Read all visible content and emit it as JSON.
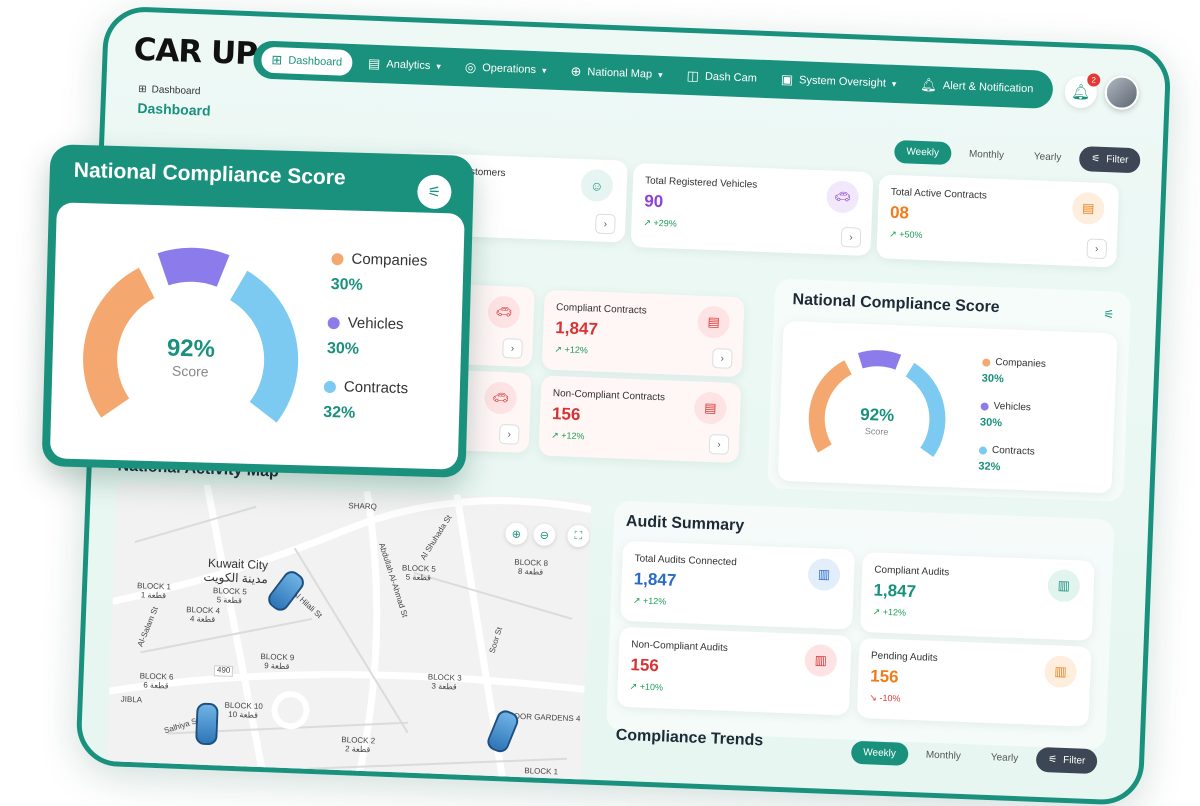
{
  "brand": {
    "logo": "CAR UP"
  },
  "nav": [
    {
      "label": "Dashboard",
      "icon": "grid-icon",
      "active": true
    },
    {
      "label": "Analytics",
      "icon": "chart-icon"
    },
    {
      "label": "Operations",
      "icon": "target-icon"
    },
    {
      "label": "National Map",
      "icon": "globe-icon"
    },
    {
      "label": "Dash Cam",
      "icon": "camera-icon"
    },
    {
      "label": "System Oversight",
      "icon": "clipboard-icon"
    },
    {
      "label": "Alert & Notification",
      "icon": "bell-icon"
    }
  ],
  "header": {
    "notification_count": "2",
    "breadcrumb": "Dashboard",
    "page_title": "Dashboard"
  },
  "period": {
    "weekly": "Weekly",
    "monthly": "Monthly",
    "yearly": "Yearly",
    "filter": "Filter"
  },
  "top_kpis": [
    {
      "label": "Total Customers"
    },
    {
      "label": "Total Registered Vehicles",
      "value": "90",
      "trend": "+29%",
      "color": "#8e44d0"
    },
    {
      "label": "Total Active Contracts",
      "value": "08",
      "trend": "+50%",
      "color": "#ef7d1a"
    }
  ],
  "mid_kpis": [
    {
      "label": "Compliant Contracts",
      "value": "1,847",
      "trend": "+12%",
      "color": "#d63434"
    },
    {
      "label": "Non-Compliant Contracts",
      "value": "156",
      "trend": "+12%",
      "color": "#d63434"
    },
    {
      "label_fragment": "les"
    }
  ],
  "compliance": {
    "title": "National Compliance Score",
    "score": "92%",
    "score_label": "Score",
    "segments": [
      {
        "name": "Companies",
        "pct": "30%",
        "color": "#f4a86f"
      },
      {
        "name": "Vehicles",
        "pct": "30%",
        "color": "#8c7bea"
      },
      {
        "name": "Contracts",
        "pct": "32%",
        "color": "#7ccaf1"
      }
    ]
  },
  "map": {
    "title": "National Activity Map",
    "labels": [
      {
        "t": "Kuwait City",
        "big": true
      },
      {
        "t": "مدينة الكويت",
        "big": true
      },
      {
        "t": "BLOCK 1"
      },
      {
        "t": "قطعة 1"
      },
      {
        "t": "BLOCK 5"
      },
      {
        "t": "قطعة 5"
      },
      {
        "t": "BLOCK 4"
      },
      {
        "t": "قطعة 4"
      },
      {
        "t": "BLOCK 6"
      },
      {
        "t": "قطعة 6"
      },
      {
        "t": "BLOCK 9"
      },
      {
        "t": "قطعة 9"
      },
      {
        "t": "BLOCK 5"
      },
      {
        "t": "قطعة 5"
      },
      {
        "t": "BLOCK 8"
      },
      {
        "t": "قطعة 8"
      },
      {
        "t": "BLOCK 3"
      },
      {
        "t": "قطعة 3"
      },
      {
        "t": "BLOCK 10"
      },
      {
        "t": "قطعة 10"
      },
      {
        "t": "BLOCK 2"
      },
      {
        "t": "قطعة 2"
      },
      {
        "t": "BLOCK 1"
      },
      {
        "t": "SHARQ"
      },
      {
        "t": "JIBLA"
      },
      {
        "t": "Al Hilali St"
      },
      {
        "t": "Al-Salam St"
      },
      {
        "t": "Abdullah Al-Ahmad St"
      },
      {
        "t": "Al Shuhada St"
      },
      {
        "t": "Soor St"
      },
      {
        "t": "Salhiya St"
      },
      {
        "t": "490"
      },
      {
        "t": "SOOR GARDENS 4"
      }
    ]
  },
  "audit": {
    "title": "Audit Summary",
    "cards": [
      {
        "label": "Total Audits Connected",
        "value": "1,847",
        "trend": "+12%",
        "color": "#2a6acb",
        "down": false
      },
      {
        "label": "Compliant Audits",
        "value": "1,847",
        "trend": "+12%",
        "color": "#19917d",
        "down": false
      },
      {
        "label": "Non-Compliant Audits",
        "value": "156",
        "trend": "+10%",
        "color": "#d63434",
        "down": false
      },
      {
        "label": "Pending Audits",
        "value": "156",
        "trend": "-10%",
        "color": "#ef7d1a",
        "down": true
      }
    ]
  },
  "trends": {
    "title": "Compliance Trends"
  }
}
